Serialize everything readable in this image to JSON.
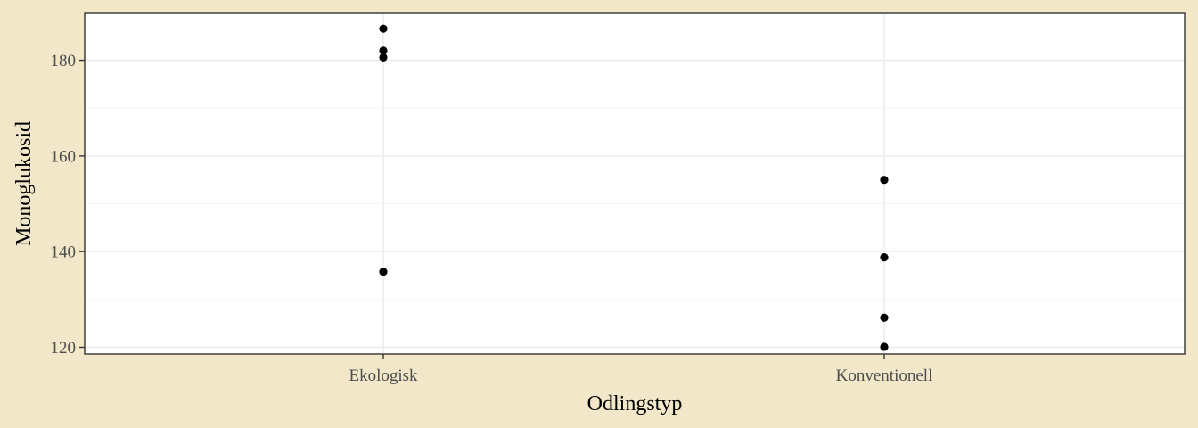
{
  "chart_data": {
    "type": "scatter",
    "title": "",
    "xlabel": "Odlingstyp",
    "ylabel": "Monoglukosid",
    "categories": [
      "Ekologisk",
      "Konventionell"
    ],
    "y_ticks": [
      120,
      140,
      160,
      180
    ],
    "y_tick_labels": [
      "120",
      "140",
      "160",
      "180"
    ],
    "ylim": [
      118.6,
      189.8
    ],
    "grid": true,
    "legend": "none",
    "points": [
      {
        "x": "Ekologisk",
        "y": 186.6
      },
      {
        "x": "Ekologisk",
        "y": 182.0
      },
      {
        "x": "Ekologisk",
        "y": 180.6
      },
      {
        "x": "Ekologisk",
        "y": 135.8
      },
      {
        "x": "Konventionell",
        "y": 155.0
      },
      {
        "x": "Konventionell",
        "y": 138.8
      },
      {
        "x": "Konventionell",
        "y": 126.2
      },
      {
        "x": "Konventionell",
        "y": 120.1
      }
    ],
    "colors": {
      "background": "#f2e8c9",
      "panel": "#ffffff",
      "point": "#000000",
      "grid": "#ebebeb",
      "border": "#333333"
    }
  }
}
